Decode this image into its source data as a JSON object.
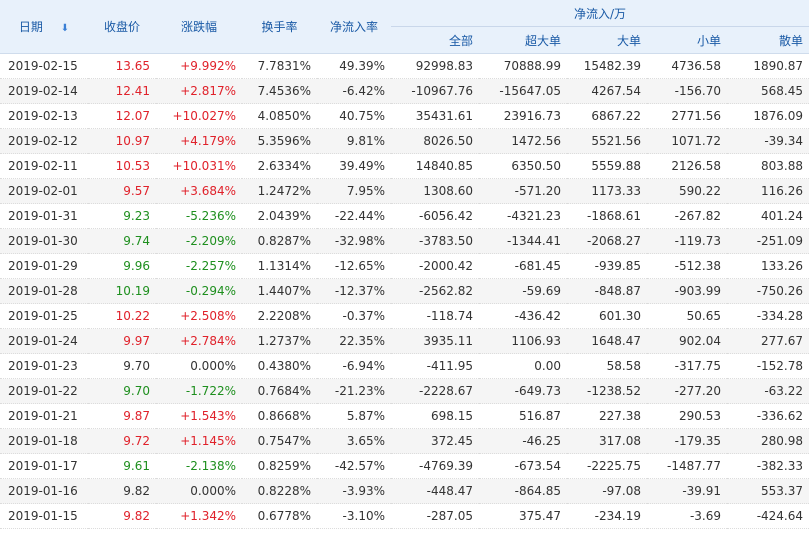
{
  "headers": {
    "date": "日期",
    "close": "收盘价",
    "change": "涨跌幅",
    "turnover": "换手率",
    "net_rate": "净流入率",
    "group": "净流入/万",
    "total": "全部",
    "super_large": "超大单",
    "large": "大单",
    "small": "小单",
    "retail": "散单"
  },
  "sort_indicator": "descending",
  "colors": {
    "up": "#e0212a",
    "down": "#1e8f1e",
    "header_bg": "#e8f1fb",
    "header_text": "#1a5aa6"
  },
  "rows": [
    {
      "date": "2019-02-15",
      "close": "13.65",
      "change": "+9.992%",
      "turnover": "7.7831%",
      "net_rate": "49.39%",
      "total": "92998.83",
      "super_large": "70888.99",
      "large": "15482.39",
      "small": "4736.58",
      "retail": "1890.87",
      "dir": "up"
    },
    {
      "date": "2019-02-14",
      "close": "12.41",
      "change": "+2.817%",
      "turnover": "7.4536%",
      "net_rate": "-6.42%",
      "total": "-10967.76",
      "super_large": "-15647.05",
      "large": "4267.54",
      "small": "-156.70",
      "retail": "568.45",
      "dir": "up"
    },
    {
      "date": "2019-02-13",
      "close": "12.07",
      "change": "+10.027%",
      "turnover": "4.0850%",
      "net_rate": "40.75%",
      "total": "35431.61",
      "super_large": "23916.73",
      "large": "6867.22",
      "small": "2771.56",
      "retail": "1876.09",
      "dir": "up"
    },
    {
      "date": "2019-02-12",
      "close": "10.97",
      "change": "+4.179%",
      "turnover": "5.3596%",
      "net_rate": "9.81%",
      "total": "8026.50",
      "super_large": "1472.56",
      "large": "5521.56",
      "small": "1071.72",
      "retail": "-39.34",
      "dir": "up"
    },
    {
      "date": "2019-02-11",
      "close": "10.53",
      "change": "+10.031%",
      "turnover": "2.6334%",
      "net_rate": "39.49%",
      "total": "14840.85",
      "super_large": "6350.50",
      "large": "5559.88",
      "small": "2126.58",
      "retail": "803.88",
      "dir": "up"
    },
    {
      "date": "2019-02-01",
      "close": "9.57",
      "change": "+3.684%",
      "turnover": "1.2472%",
      "net_rate": "7.95%",
      "total": "1308.60",
      "super_large": "-571.20",
      "large": "1173.33",
      "small": "590.22",
      "retail": "116.26",
      "dir": "up"
    },
    {
      "date": "2019-01-31",
      "close": "9.23",
      "change": "-5.236%",
      "turnover": "2.0439%",
      "net_rate": "-22.44%",
      "total": "-6056.42",
      "super_large": "-4321.23",
      "large": "-1868.61",
      "small": "-267.82",
      "retail": "401.24",
      "dir": "down"
    },
    {
      "date": "2019-01-30",
      "close": "9.74",
      "change": "-2.209%",
      "turnover": "0.8287%",
      "net_rate": "-32.98%",
      "total": "-3783.50",
      "super_large": "-1344.41",
      "large": "-2068.27",
      "small": "-119.73",
      "retail": "-251.09",
      "dir": "down"
    },
    {
      "date": "2019-01-29",
      "close": "9.96",
      "change": "-2.257%",
      "turnover": "1.1314%",
      "net_rate": "-12.65%",
      "total": "-2000.42",
      "super_large": "-681.45",
      "large": "-939.85",
      "small": "-512.38",
      "retail": "133.26",
      "dir": "down"
    },
    {
      "date": "2019-01-28",
      "close": "10.19",
      "change": "-0.294%",
      "turnover": "1.4407%",
      "net_rate": "-12.37%",
      "total": "-2562.82",
      "super_large": "-59.69",
      "large": "-848.87",
      "small": "-903.99",
      "retail": "-750.26",
      "dir": "down"
    },
    {
      "date": "2019-01-25",
      "close": "10.22",
      "change": "+2.508%",
      "turnover": "2.2208%",
      "net_rate": "-0.37%",
      "total": "-118.74",
      "super_large": "-436.42",
      "large": "601.30",
      "small": "50.65",
      "retail": "-334.28",
      "dir": "up"
    },
    {
      "date": "2019-01-24",
      "close": "9.97",
      "change": "+2.784%",
      "turnover": "1.2737%",
      "net_rate": "22.35%",
      "total": "3935.11",
      "super_large": "1106.93",
      "large": "1648.47",
      "small": "902.04",
      "retail": "277.67",
      "dir": "up"
    },
    {
      "date": "2019-01-23",
      "close": "9.70",
      "change": "0.000%",
      "turnover": "0.4380%",
      "net_rate": "-6.94%",
      "total": "-411.95",
      "super_large": "0.00",
      "large": "58.58",
      "small": "-317.75",
      "retail": "-152.78",
      "dir": "flat"
    },
    {
      "date": "2019-01-22",
      "close": "9.70",
      "change": "-1.722%",
      "turnover": "0.7684%",
      "net_rate": "-21.23%",
      "total": "-2228.67",
      "super_large": "-649.73",
      "large": "-1238.52",
      "small": "-277.20",
      "retail": "-63.22",
      "dir": "down"
    },
    {
      "date": "2019-01-21",
      "close": "9.87",
      "change": "+1.543%",
      "turnover": "0.8668%",
      "net_rate": "5.87%",
      "total": "698.15",
      "super_large": "516.87",
      "large": "227.38",
      "small": "290.53",
      "retail": "-336.62",
      "dir": "up"
    },
    {
      "date": "2019-01-18",
      "close": "9.72",
      "change": "+1.145%",
      "turnover": "0.7547%",
      "net_rate": "3.65%",
      "total": "372.45",
      "super_large": "-46.25",
      "large": "317.08",
      "small": "-179.35",
      "retail": "280.98",
      "dir": "up"
    },
    {
      "date": "2019-01-17",
      "close": "9.61",
      "change": "-2.138%",
      "turnover": "0.8259%",
      "net_rate": "-42.57%",
      "total": "-4769.39",
      "super_large": "-673.54",
      "large": "-2225.75",
      "small": "-1487.77",
      "retail": "-382.33",
      "dir": "down"
    },
    {
      "date": "2019-01-16",
      "close": "9.82",
      "change": "0.000%",
      "turnover": "0.8228%",
      "net_rate": "-3.93%",
      "total": "-448.47",
      "super_large": "-864.85",
      "large": "-97.08",
      "small": "-39.91",
      "retail": "553.37",
      "dir": "flat"
    },
    {
      "date": "2019-01-15",
      "close": "9.82",
      "change": "+1.342%",
      "turnover": "0.6778%",
      "net_rate": "-3.10%",
      "total": "-287.05",
      "super_large": "375.47",
      "large": "-234.19",
      "small": "-3.69",
      "retail": "-424.64",
      "dir": "up"
    }
  ]
}
